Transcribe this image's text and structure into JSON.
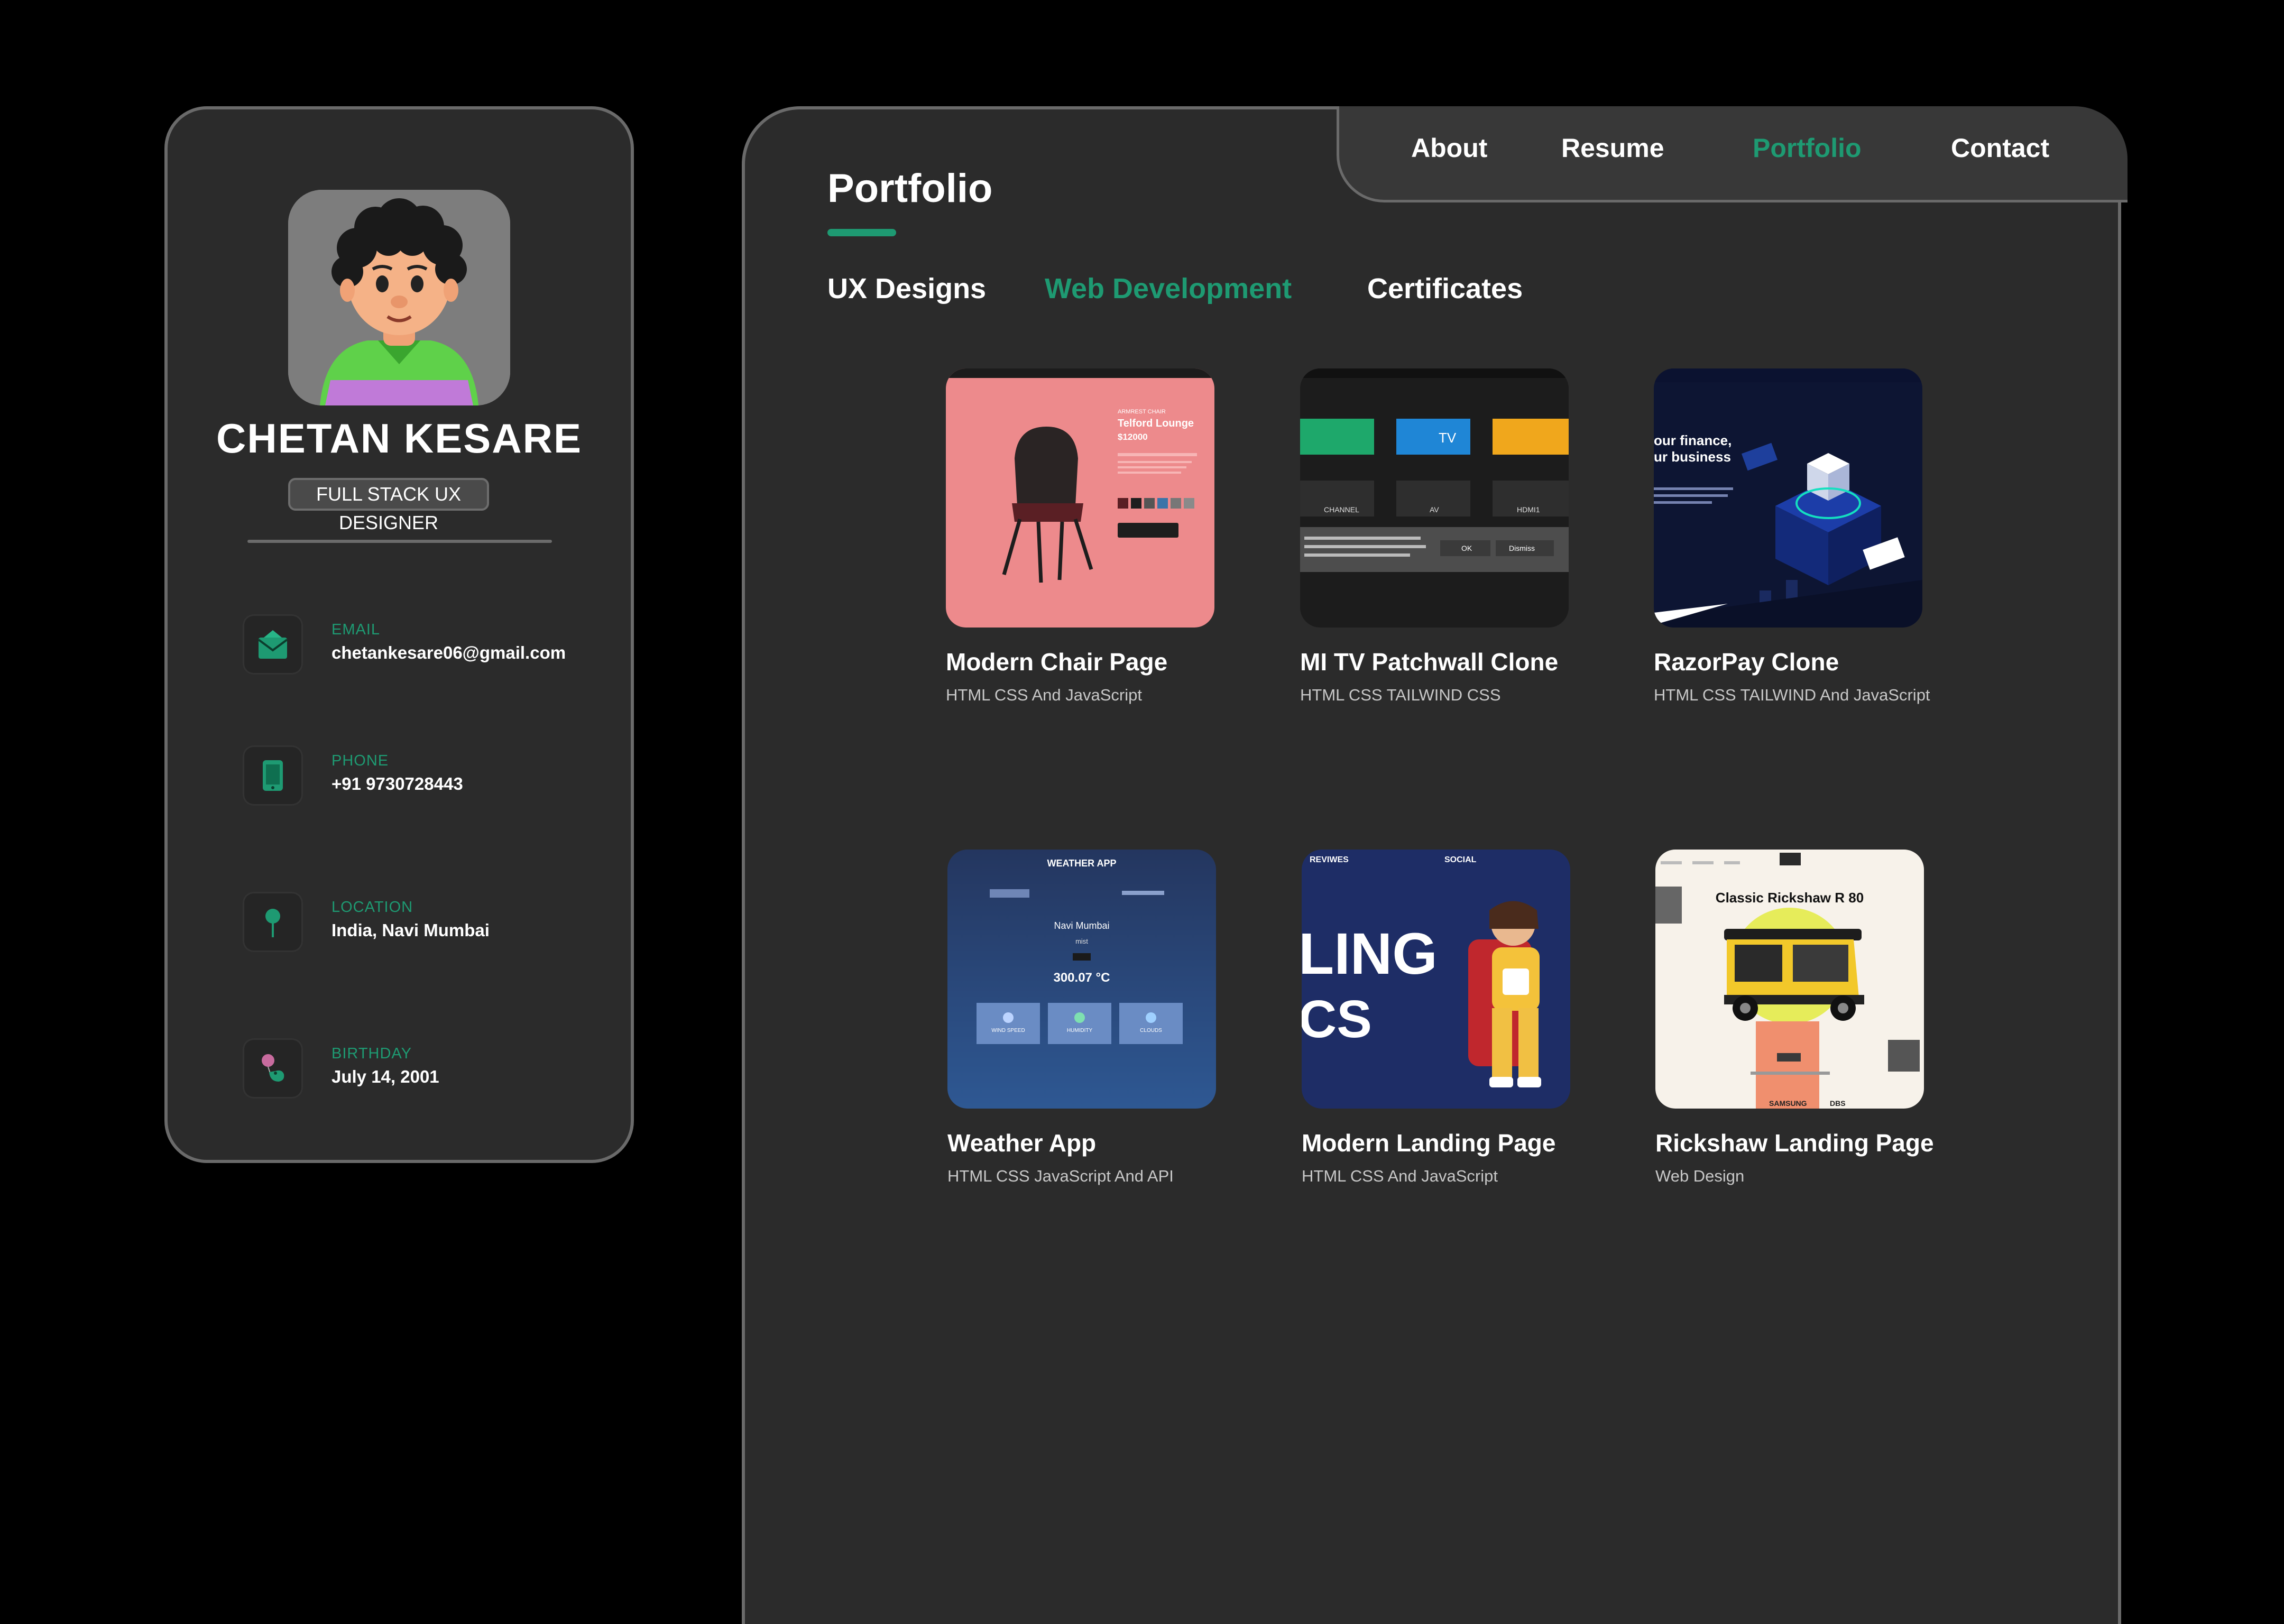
{
  "profile": {
    "name": "CHETAN KESARE",
    "role": "FULL STACK UX DESIGNER",
    "info": [
      {
        "label": "EMAIL",
        "value": "chetankesare06@gmail.com",
        "icon": "mail-icon"
      },
      {
        "label": "PHONE",
        "value": "+91  9730728443",
        "icon": "phone-icon"
      },
      {
        "label": "LOCATION",
        "value": "India, Navi Mumbai",
        "icon": "location-pin-icon"
      },
      {
        "label": "BIRTHDAY",
        "value": "July 14, 2001",
        "icon": "balloon-icon"
      }
    ]
  },
  "nav": {
    "items": [
      "About",
      "Resume",
      "Portfolio",
      "Contact"
    ],
    "active": "Portfolio"
  },
  "page": {
    "title": "Portfolio",
    "tabs": [
      "UX Designs",
      "Web Development",
      "Certificates"
    ],
    "active_tab": "Web Development"
  },
  "projects": [
    {
      "title": "Modern Chair Page",
      "subtitle": "HTML CSS And JavaScript",
      "thumb": {
        "heading": "Telford Lounge",
        "price": "$12000"
      }
    },
    {
      "title": "MI TV Patchwall Clone",
      "subtitle": "HTML CSS TAILWIND CSS",
      "thumb": {
        "tiles": [
          "TV",
          "CHANNEL",
          "AV",
          "HDMI1"
        ],
        "ok": "OK",
        "dismiss": "Dismiss"
      }
    },
    {
      "title": "RazorPay Clone",
      "subtitle": "HTML CSS TAILWIND And JavaScript",
      "thumb": {
        "line1": "our finance,",
        "line2": "ur business"
      }
    },
    {
      "title": "Weather App",
      "subtitle": "HTML CSS JavaScript And API",
      "thumb": {
        "heading": "WEATHER APP",
        "city": "Navi Mumbai",
        "desc": "mist",
        "temp": "300.07 °C",
        "stats": [
          "WIND SPEED",
          "HUMIDITY",
          "CLOUDS"
        ]
      }
    },
    {
      "title": "Modern Landing Page",
      "subtitle": "HTML CSS And JavaScript",
      "thumb": {
        "nav1": "REVIWES",
        "nav2": "SOCIAL",
        "big1": "LING",
        "big2": "CS"
      }
    },
    {
      "title": "Rickshaw Landing Page",
      "subtitle": "Web Design",
      "thumb": {
        "heading": "Classic Rickshaw R 80",
        "brand1": "SAMSUNG",
        "brand2": "DBS"
      }
    }
  ],
  "colors": {
    "accent": "#1e9a72",
    "panel": "#2b2b2b",
    "border": "#6a6a6a",
    "background": "#000000"
  }
}
